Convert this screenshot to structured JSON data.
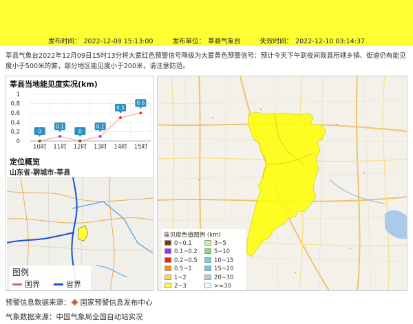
{
  "header": {
    "publish_time_label": "发布时间：",
    "publish_time": "2022-12-09 15:13:00",
    "publisher_label": "发布单位：",
    "publisher": "莘县气象台",
    "expire_label": "失效时间：",
    "expire_time": "2022-12-10 03:14:37",
    "banner_color": "#ffff33"
  },
  "description": "莘县气象台2022年12月09日15时13分将大雾红色预警信号降级为大雾黄色预警信号：预计今天下午到夜间我县所辖乡镇、街道仍有能见度小于500米的雾，部分地区能见度小于200米，请注意防范。",
  "visibility_panel": {
    "title": "莘县当地能见度实况(km)"
  },
  "chart_data": {
    "type": "line",
    "title": "莘县当地能见度实况(km)",
    "categories": [
      "10时",
      "11时",
      "12时",
      "13时",
      "14时",
      "15时"
    ],
    "values": [
      0,
      0.1,
      0,
      0.1,
      0.5,
      0.6
    ],
    "value_labels": [
      "0",
      "0.1",
      "0",
      "0.1",
      "0.5",
      "0.6"
    ],
    "y_ticks": [
      "0",
      "0.2",
      "0.4",
      "0.6",
      "0.8",
      "1"
    ],
    "ylim": [
      0,
      1
    ],
    "grid": true,
    "label_color": "#2a8fbd",
    "point_colors": [
      "#7a4a1a",
      "#9b30ff",
      "#7a4a1a",
      "#9b30ff",
      "#ff3300",
      "#ff3300"
    ]
  },
  "location": {
    "title": "定位概览",
    "path": "山东省-聊城市-莘县",
    "legend_title": "图例",
    "legend_items": [
      {
        "label": "国界",
        "color": "#c46a8a"
      },
      {
        "label": "省界",
        "color": "#1a4fd6"
      }
    ]
  },
  "visibility_legend": {
    "title": "能见度色值图例 (km)",
    "items": [
      {
        "label": "0~0.1",
        "color": "#7a3b10"
      },
      {
        "label": "3~5",
        "color": "#c8f08c"
      },
      {
        "label": "0.1~0.2",
        "color": "#9b30ff"
      },
      {
        "label": "5~10",
        "color": "#7fe07f"
      },
      {
        "label": "0.2~0.5",
        "color": "#ff1a1a"
      },
      {
        "label": "10~15",
        "color": "#66d9c8"
      },
      {
        "label": "0.5~1",
        "color": "#ff8c1a"
      },
      {
        "label": "15~20",
        "color": "#6cc6e8"
      },
      {
        "label": "1~2",
        "color": "#ffd24d"
      },
      {
        "label": "20~30",
        "color": "#9fd4f0"
      },
      {
        "label": "2~3",
        "color": "#ffff33"
      },
      {
        "label": ">=30",
        "color": "#ffffff"
      }
    ]
  },
  "footer": {
    "warning_source": "预警信息数据来源：",
    "warning_source_name": "国家预警信息发布中心",
    "weather_source": "气象数据来源：中国气象局全国自动站实况"
  }
}
